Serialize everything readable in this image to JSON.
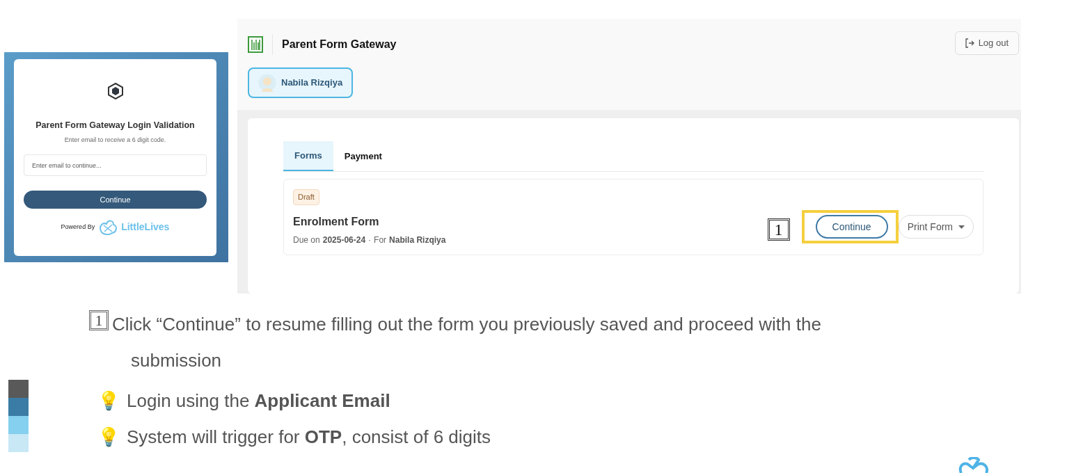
{
  "login": {
    "title": "Parent Form Gateway Login Validation",
    "subtitle": "Enter email to receive a 6 digit code.",
    "email_placeholder": "Enter email to continue...",
    "button": "Continue",
    "powered_by": "Powered By",
    "brand": "LittleLives"
  },
  "app": {
    "title": "Parent Form Gateway",
    "logout": "Log out",
    "child": "Nabila Rizqiya",
    "tabs": [
      {
        "label": "Forms",
        "selected": true
      },
      {
        "label": "Payment",
        "selected": false
      }
    ],
    "forms": [
      {
        "status": "Draft",
        "name": "Enrolment Form",
        "due_label": "Due on",
        "due": "2025-06-24",
        "separator": "·",
        "for_label": "For",
        "for": "Nabila Rizqiya",
        "step": "1",
        "continue": "Continue",
        "print": "Print Form"
      }
    ]
  },
  "instructions": [
    {
      "kind": "step",
      "marker": "1",
      "text": "Click “Continue” to resume filling out the form you previously saved and proceed with the submission"
    },
    {
      "kind": "tip",
      "marker": "💡",
      "text": "Login using the **Applicant Email**"
    },
    {
      "kind": "tip",
      "marker": "💡",
      "text": "System will trigger for **OTP**, consist of 6 digits"
    }
  ],
  "color_strip": [
    {
      "color": "#595959"
    },
    {
      "color": "#3a7ca5"
    },
    {
      "color": "#85d0ee"
    },
    {
      "color": "#c8e8f5"
    }
  ]
}
